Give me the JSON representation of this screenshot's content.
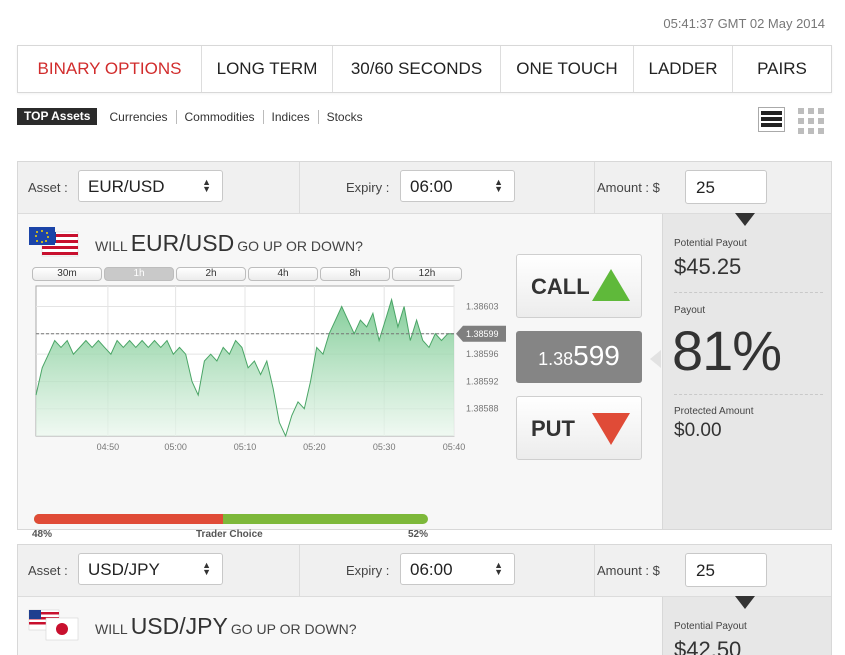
{
  "clock": "05:41:37 GMT 02 May 2014",
  "nav": {
    "tabs": [
      {
        "label": "BINARY OPTIONS",
        "active": true
      },
      {
        "label": "LONG TERM"
      },
      {
        "label": "30/60 SECONDS"
      },
      {
        "label": "ONE TOUCH"
      },
      {
        "label": "LADDER"
      },
      {
        "label": "PAIRS"
      }
    ]
  },
  "subnav": [
    "TOP Assets",
    "Currencies",
    "Commodities",
    "Indices",
    "Stocks"
  ],
  "labels": {
    "asset": "Asset :",
    "expiry": "Expiry :",
    "amount": "Amount : $",
    "will": "WILL",
    "up_down": "GO UP OR DOWN?",
    "potential_payout": "Potential Payout",
    "payout": "Payout",
    "protected": "Protected Amount",
    "call": "CALL",
    "put": "PUT",
    "trader_choice": "Trader Choice"
  },
  "panels": [
    {
      "asset": "EUR/USD",
      "expiry": "06:00",
      "amount": "25",
      "potential_payout": "$45.25",
      "payout": "81%",
      "protected_amount": "$0.00",
      "price_small": "1.38",
      "price_big": "599",
      "timeframes": [
        "30m",
        "1h",
        "2h",
        "4h",
        "8h",
        "12h"
      ],
      "active_timeframe": 1,
      "trader_choice": {
        "put_pct": "48%",
        "call_pct": "52%",
        "put_fraction": 0.48
      }
    },
    {
      "asset": "USD/JPY",
      "expiry": "06:00",
      "amount": "25",
      "potential_payout": "$42.50"
    }
  ],
  "chart_data": {
    "type": "area",
    "x_ticks": [
      "04:50",
      "05:00",
      "05:10",
      "05:20",
      "05:30",
      "05:40"
    ],
    "y_ticks": [
      "1.38603",
      "1.38599",
      "1.38596",
      "1.38592",
      "1.38588"
    ],
    "ylim": [
      1.38584,
      1.38606
    ],
    "current_label": "1.38599",
    "current_value": 1.38599,
    "grid": true,
    "values": [
      1.3859,
      1.38594,
      1.38596,
      1.38598,
      1.38597,
      1.38598,
      1.38596,
      1.38597,
      1.38598,
      1.38597,
      1.38598,
      1.38597,
      1.38596,
      1.38598,
      1.38597,
      1.38598,
      1.38597,
      1.38598,
      1.38597,
      1.38598,
      1.38597,
      1.38598,
      1.38596,
      1.38597,
      1.38596,
      1.38592,
      1.3859,
      1.38595,
      1.38596,
      1.38595,
      1.38597,
      1.38596,
      1.38598,
      1.38597,
      1.38594,
      1.38595,
      1.38593,
      1.38595,
      1.38591,
      1.38586,
      1.38584,
      1.38587,
      1.38589,
      1.38588,
      1.38592,
      1.38597,
      1.38596,
      1.38599,
      1.38601,
      1.38603,
      1.38601,
      1.38599,
      1.38601,
      1.386,
      1.38602,
      1.38598,
      1.38601,
      1.38604,
      1.386,
      1.38603,
      1.38598,
      1.38601,
      1.38598,
      1.38597,
      1.38599,
      1.38598,
      1.38599,
      1.38599
    ]
  }
}
